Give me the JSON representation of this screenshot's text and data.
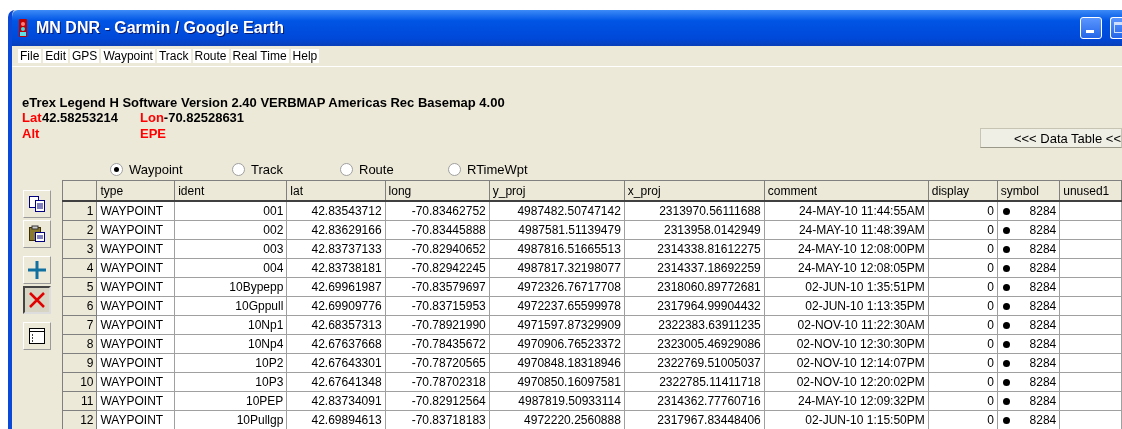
{
  "window": {
    "title": "MN DNR - Garmin / Google Earth"
  },
  "menu": [
    "File",
    "Edit",
    "GPS",
    "Waypoint",
    "Track",
    "Route",
    "Real Time",
    "Help"
  ],
  "device_info": "eTrex Legend H Software Version 2.40 VERBMAP Americas Rec Basemap 4.00",
  "position": {
    "lat_label": "Lat",
    "lat": "42.58253214",
    "lon_label": "Lon",
    "lon": "-70.82528631",
    "alt_label": "Alt",
    "epe_label": "EPE"
  },
  "data_table_button": "<<< Data Table <<",
  "data_types": [
    {
      "label": "Waypoint",
      "selected": true
    },
    {
      "label": "Track",
      "selected": false
    },
    {
      "label": "Route",
      "selected": false
    },
    {
      "label": "RTimeWpt",
      "selected": false
    }
  ],
  "toolbar": [
    {
      "kind": "copy",
      "pressed": false
    },
    {
      "kind": "paste",
      "pressed": false
    },
    {
      "kind": "add",
      "pressed": false
    },
    {
      "kind": "delete",
      "pressed": true
    },
    {
      "kind": "list",
      "pressed": false
    }
  ],
  "table": {
    "columns": [
      "type",
      "ident",
      "lat",
      "long",
      "y_proj",
      "x_proj",
      "comment",
      "display",
      "symbol",
      "unused1"
    ],
    "rows": [
      {
        "num": "1",
        "type": "WAYPOINT",
        "ident": "001",
        "lat": "42.83543712",
        "long": "-70.83462752",
        "y_proj": "4987482.50747142",
        "x_proj": "2313970.56111688",
        "comment": "24-MAY-10 11:44:55AM",
        "display": "0",
        "symbol": "8284"
      },
      {
        "num": "2",
        "type": "WAYPOINT",
        "ident": "002",
        "lat": "42.83629166",
        "long": "-70.83445888",
        "y_proj": "4987581.51139479",
        "x_proj": "2313958.0142949",
        "comment": "24-MAY-10 11:48:39AM",
        "display": "0",
        "symbol": "8284"
      },
      {
        "num": "3",
        "type": "WAYPOINT",
        "ident": "003",
        "lat": "42.83737133",
        "long": "-70.82940652",
        "y_proj": "4987816.51665513",
        "x_proj": "2314338.81612275",
        "comment": "24-MAY-10 12:08:00PM",
        "display": "0",
        "symbol": "8284"
      },
      {
        "num": "4",
        "type": "WAYPOINT",
        "ident": "004",
        "lat": "42.83738181",
        "long": "-70.82942245",
        "y_proj": "4987817.32198077",
        "x_proj": "2314337.18692259",
        "comment": "24-MAY-10 12:08:05PM",
        "display": "0",
        "symbol": "8284"
      },
      {
        "num": "5",
        "type": "WAYPOINT",
        "ident": "10Bypepp",
        "lat": "42.69961987",
        "long": "-70.83579697",
        "y_proj": "4972326.76717708",
        "x_proj": "2318060.89772681",
        "comment": "02-JUN-10 1:35:51PM",
        "display": "0",
        "symbol": "8284"
      },
      {
        "num": "6",
        "type": "WAYPOINT",
        "ident": "10Gppull",
        "lat": "42.69909776",
        "long": "-70.83715953",
        "y_proj": "4972237.65599978",
        "x_proj": "2317964.99904432",
        "comment": "02-JUN-10 1:13:35PM",
        "display": "0",
        "symbol": "8284"
      },
      {
        "num": "7",
        "type": "WAYPOINT",
        "ident": "10Np1",
        "lat": "42.68357313",
        "long": "-70.78921990",
        "y_proj": "4971597.87329909",
        "x_proj": "2322383.63911235",
        "comment": "02-NOV-10 11:22:30AM",
        "display": "0",
        "symbol": "8284"
      },
      {
        "num": "8",
        "type": "WAYPOINT",
        "ident": "10Np4",
        "lat": "42.67637668",
        "long": "-70.78435672",
        "y_proj": "4970906.76523372",
        "x_proj": "2323005.46929086",
        "comment": "02-NOV-10 12:30:30PM",
        "display": "0",
        "symbol": "8284"
      },
      {
        "num": "9",
        "type": "WAYPOINT",
        "ident": "10P2",
        "lat": "42.67643301",
        "long": "-70.78720565",
        "y_proj": "4970848.18318946",
        "x_proj": "2322769.51005037",
        "comment": "02-NOV-10 12:14:07PM",
        "display": "0",
        "symbol": "8284"
      },
      {
        "num": "10",
        "type": "WAYPOINT",
        "ident": "10P3",
        "lat": "42.67641348",
        "long": "-70.78702318",
        "y_proj": "4970850.16097581",
        "x_proj": "2322785.11411718",
        "comment": "02-NOV-10 12:20:02PM",
        "display": "0",
        "symbol": "8284"
      },
      {
        "num": "11",
        "type": "WAYPOINT",
        "ident": "10PEP",
        "lat": "42.83734091",
        "long": "-70.82912564",
        "y_proj": "4987819.50933114",
        "x_proj": "2314362.77760716",
        "comment": "24-MAY-10 12:09:32PM",
        "display": "0",
        "symbol": "8284"
      },
      {
        "num": "12",
        "type": "WAYPOINT",
        "ident": "10Pullgp",
        "lat": "42.69894613",
        "long": "-70.83718183",
        "y_proj": "4972220.2560888",
        "x_proj": "2317967.83448406",
        "comment": "02-JUN-10 1:15:50PM",
        "display": "0",
        "symbol": "8284"
      }
    ]
  }
}
